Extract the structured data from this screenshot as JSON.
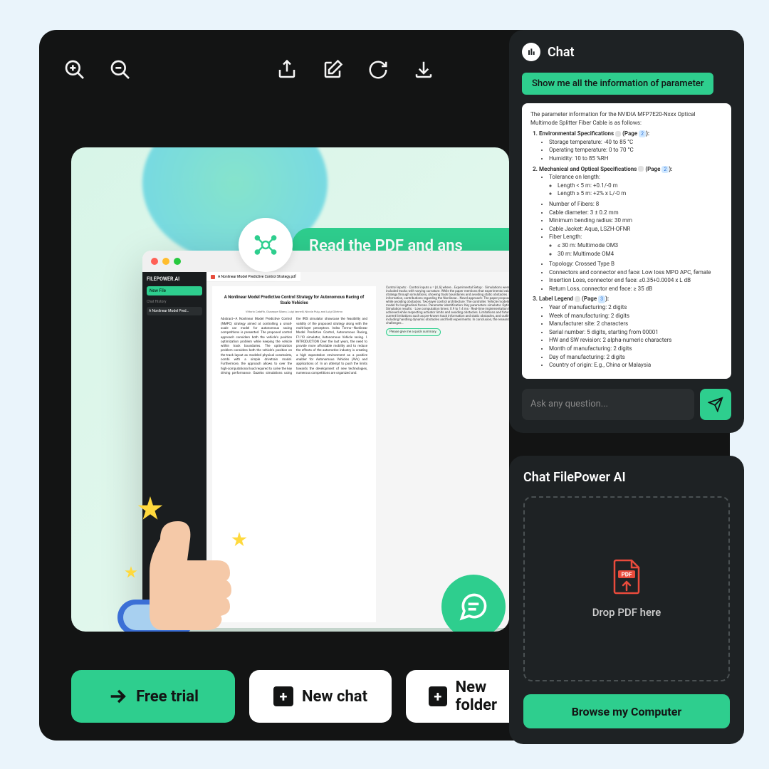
{
  "toolbar": {
    "icons": [
      "zoom-in",
      "zoom-out",
      "share",
      "edit",
      "reload",
      "download"
    ]
  },
  "preview": {
    "banner": "Read the PDF and ans",
    "window": {
      "brand": "FILEPOWER.AI",
      "new_file": "New File",
      "chat_history": "Chat History",
      "history_item": "A Nonlinear Model Pred…",
      "tab": "A Nonlinear Model Predictive Control Strategy.pdf",
      "doc_title": "A Nonlinear Model Predictive Control Strategy for Autonomous Racing of Scale Vehicles",
      "doc_authors": "Vittorio Cataffo, Giuseppe Silano, Luigi Iannelli, Nicola Puig, and Luigi Glielmo",
      "summary_prompt": "Please give me a quick summary.",
      "right_text": "Control inputs: · Control inputs u = [d, δ] where… Experimental Setup: · Simulations were performed in the… · Scenarios included tracks with varying curvature. While the paper mentions that experimental values are not provided in the given strategy through simulations, showing track boundaries and avoiding static obstacles. Based on the research paper information, contributions regarding the Nonlinear… Novel approach: The paper proposes focusing on optimizing lap time while avoiding obstacles. Two-layer control architecture: The controller. Vehicle modeling: It uses a simplified drivetrain model for longitudinal forces. Parameter identification: Key parameters simulator. Optimization problem: The formulated… Simulation results: · Low computation times: 0.9 to 1.4 ms · Real-time implementation feasibility · High vehicle velocities achieved while respecting actuator limits and avoiding obstacles. Limitations and future work: The paper acknowledges current limitations such as pre-known track information and static obstacles, and outlines future research directions including handling dynamic obstacles and field experiments. In conclusion, the research presents vehicles, addressing key challenges…"
    }
  },
  "actions": {
    "free_trial": "Free trial",
    "new_chat": "New chat",
    "new_folder": "New folder"
  },
  "chat_panel": {
    "title": "Chat",
    "prompt": "Show me all the information of parameter",
    "intro": "The parameter information for the NVIDIA MFP7E20-Nxxx Optical Multimode Splitter Fiber Cable is as follows:",
    "sections": [
      {
        "heading": "Environmental Specifications",
        "page": "2",
        "items": [
          "Storage temperature: -40 to 85 °C",
          "Operating temperature: 0 to 70 °C",
          "Humidity: 10 to 85 %RH"
        ]
      },
      {
        "heading": "Mechanical and Optical Specifications",
        "page": "2",
        "items": [
          "Tolerance on length:",
          "Number of Fibers: 8",
          "Cable diameter: 3 ± 0.2 mm",
          "Minimum bending radius: 30 mm",
          "Cable Jacket: Aqua, LSZH-OFNR",
          "Fiber Length:",
          "Topology: Crossed Type B",
          "Connectors and connector end face: Low loss MPO APC, female",
          "Insertion Loss, connector end face: ≤0.35+0.0004 x L dB",
          "Return Loss, connector end face: ≥ 35 dB"
        ],
        "sub_tolerance": [
          "Length < 5 m: +0.1/-0 m",
          "Length ≥ 5 m: +2% x L/-0 m"
        ],
        "sub_fiber": [
          "≤ 30 m: Multimode OM3",
          "30 m: Multimode OM4"
        ]
      },
      {
        "heading": "Label Legend",
        "page": "3",
        "items": [
          "Year of manufacturing: 2 digits",
          "Week of manufacturing: 2 digits",
          "Manufacturer site: 2 characters",
          "Serial number: 5 digits, starting from 00001",
          "HW and SW revision: 2 alpha-numeric characters",
          "Month of manufacturing: 2 digits",
          "Day of manufacturing: 2 digits",
          "Country of origin: E.g., China or Malaysia"
        ]
      }
    ],
    "input_placeholder": "Ask any question..."
  },
  "upload_panel": {
    "title": "Chat FilePower AI",
    "drop_text": "Drop PDF here",
    "pdf_badge": "PDF",
    "browse": "Browse my Computer"
  }
}
